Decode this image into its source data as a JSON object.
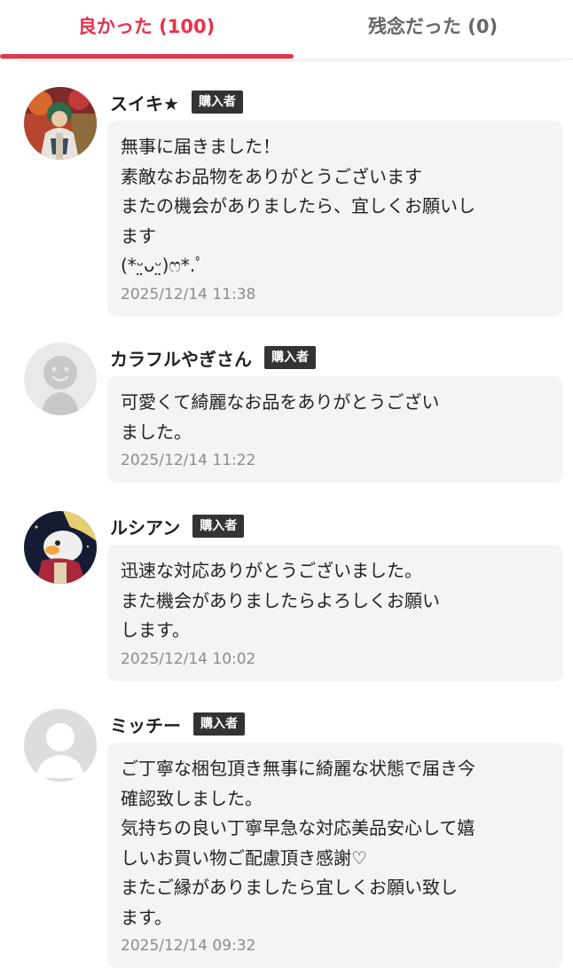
{
  "tabs": {
    "good": "良かった (100)",
    "bad": "残念だった (0)"
  },
  "colors": {
    "accent": "#e4334a",
    "badge": "#333333",
    "bubble": "#f4f4f4"
  },
  "reviews": [
    {
      "name": "スイキ★",
      "badge": "購入者",
      "avatar": "illustrated-character-avatar",
      "comment": "無事に届きました！\n素敵なお品物をありがとうございます\nまたの機会がありましたら、宜しくお願いし\nます\n(*ᵕ̤ᴗᵕ̤)ෆ*.ﾟ",
      "date": "2025/12/14 11:38"
    },
    {
      "name": "カラフルやぎさん",
      "badge": "購入者",
      "avatar": "smiley-default-avatar",
      "comment": "可愛くて綺麗なお品をありがとうござい\nました。",
      "date": "2025/12/14 11:22"
    },
    {
      "name": "ルシアン",
      "badge": "購入者",
      "avatar": "anime-character-avatar",
      "comment": "迅速な対応ありがとうございました。\nまた機会がありましたらよろしくお願い\nします。",
      "date": "2025/12/14 10:02"
    },
    {
      "name": "ミッチー",
      "badge": "購入者",
      "avatar": "default-user-avatar",
      "comment": "ご丁寧な梱包頂き無事に綺麗な状態で届き今\n確認致しました。\n気持ちの良い丁寧早急な対応美品安心して嬉\nしいお買い物ご配慮頂き感謝♡\nまたご縁がありましたら宜しくお願い致し\nます。",
      "date": "2025/12/14 09:32"
    }
  ]
}
